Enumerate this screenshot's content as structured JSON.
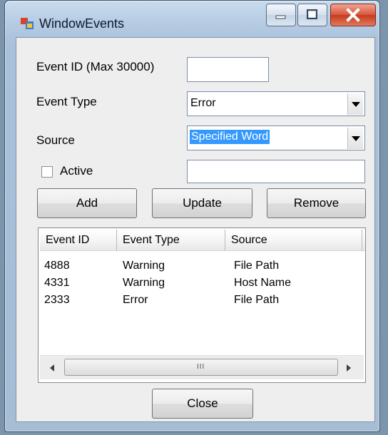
{
  "window": {
    "title": "WindowEvents"
  },
  "form": {
    "event_id_label": "Event ID (Max 30000)",
    "event_id_value": "",
    "event_type_label": "Event Type",
    "event_type_value": "Error",
    "source_label": "Source",
    "source_value": "Specified Word",
    "active_label": "Active",
    "active_checked": false,
    "word_value": ""
  },
  "buttons": {
    "add": "Add",
    "update": "Update",
    "remove": "Remove",
    "close": "Close"
  },
  "list": {
    "columns": [
      "Event ID",
      "Event Type",
      "Source"
    ],
    "rows": [
      [
        "4888",
        "Warning",
        "File Path"
      ],
      [
        "4331",
        "Warning",
        "Host Name"
      ],
      [
        "2333",
        "Error",
        "File Path"
      ]
    ],
    "scroll_grip": "III"
  },
  "icons": {
    "app": "window-app-icon",
    "minimize": "minimize-icon",
    "maximize": "maximize-icon",
    "close": "close-icon"
  },
  "colors": {
    "selection": "#3399ff",
    "close_button": "#c63a1e"
  }
}
